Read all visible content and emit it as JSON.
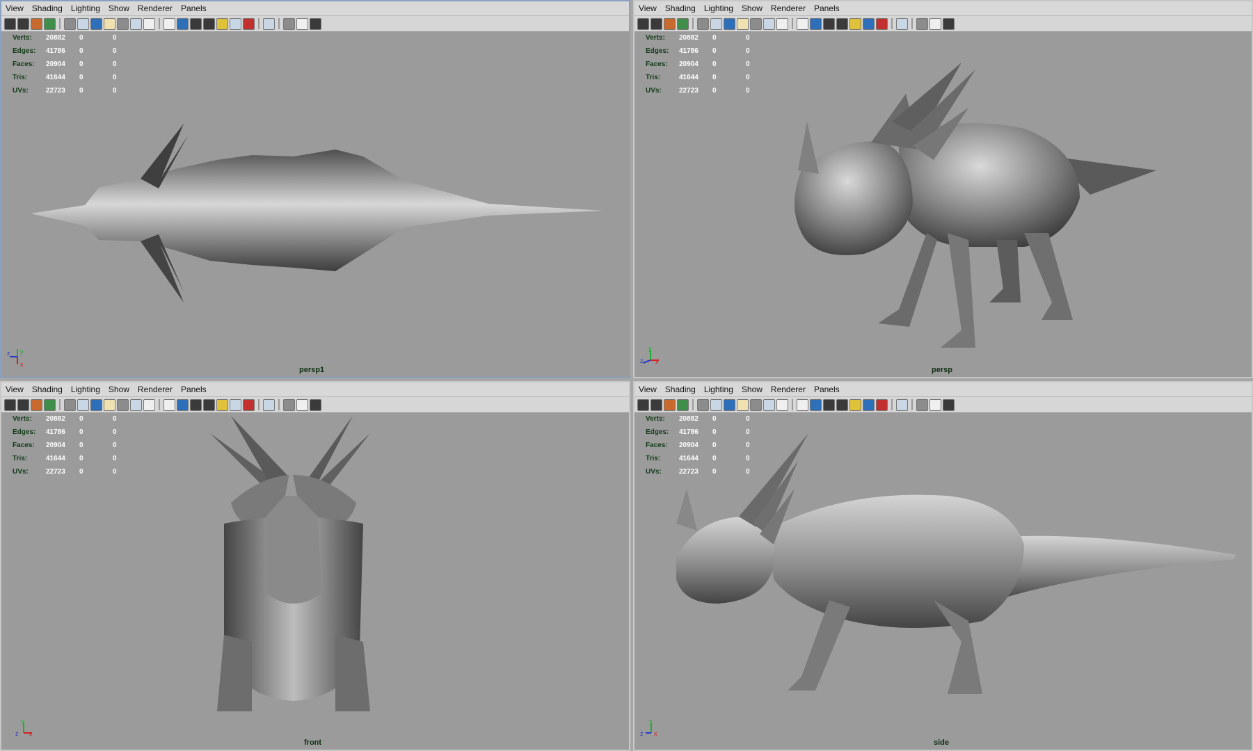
{
  "menus": [
    "View",
    "Shading",
    "Lighting",
    "Show",
    "Renderer",
    "Panels"
  ],
  "hud": {
    "rows": [
      {
        "label": "Verts:",
        "value": "20882",
        "z1": "0",
        "z2": "0"
      },
      {
        "label": "Edges:",
        "value": "41786",
        "z1": "0",
        "z2": "0"
      },
      {
        "label": "Faces:",
        "value": "20904",
        "z1": "0",
        "z2": "0"
      },
      {
        "label": "Tris:",
        "value": "41644",
        "z1": "0",
        "z2": "0"
      },
      {
        "label": "UVs:",
        "value": "22723",
        "z1": "0",
        "z2": "0"
      }
    ]
  },
  "panels": {
    "top_left": {
      "camera": "persp1",
      "axis": [
        "z",
        "y",
        "x"
      ]
    },
    "top_right": {
      "camera": "persp",
      "axis": [
        "z",
        "y",
        "x"
      ]
    },
    "bottom_left": {
      "camera": "front",
      "axis": [
        "z",
        "y",
        "x"
      ]
    },
    "bottom_right": {
      "camera": "side",
      "axis": [
        "z",
        "y",
        "x"
      ]
    }
  },
  "colors": {
    "viewport_bg": "#9b9b9b",
    "hud_label": "#123a18",
    "axis_x": "#d42020",
    "axis_y": "#1fae2f",
    "axis_z": "#2a39c9"
  },
  "toolbar_icons": [
    "camera-icon",
    "camera-attr-icon",
    "bookmark-icon",
    "image-plane-icon",
    "grid-icon",
    "film-gate-icon",
    "resolution-gate-icon",
    "field-chart-icon",
    "safe-action-icon",
    "wireframe-icon",
    "smooth-shade-icon",
    "smooth-shade-all-icon",
    "flat-shade-icon",
    "lights-icon",
    "textured-icon",
    "xray-icon",
    "isolate-icon",
    "hud-icon",
    "grid-toggle-icon",
    "render-icon"
  ]
}
